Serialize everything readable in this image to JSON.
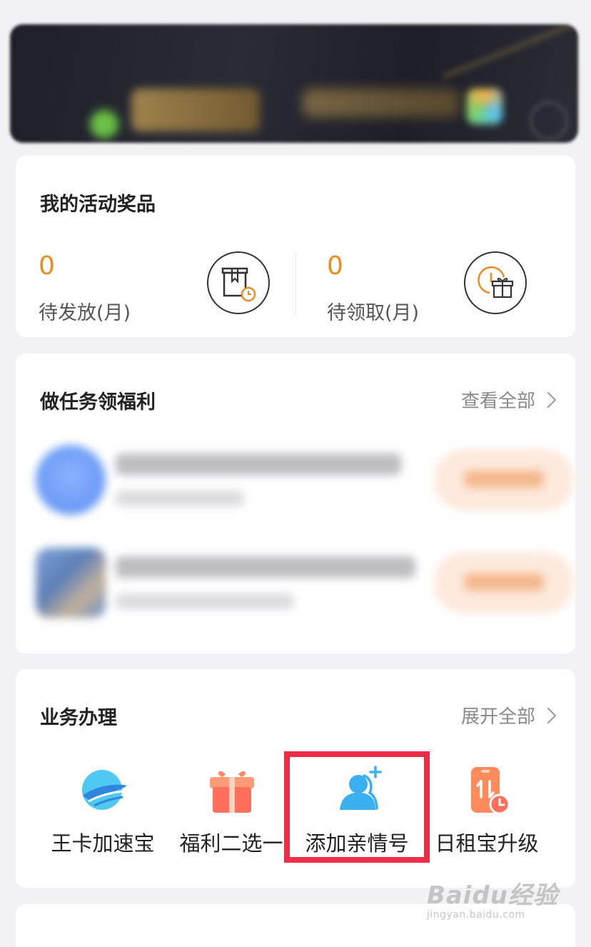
{
  "prizes": {
    "title": "我的活动奖品",
    "pending_release": {
      "value": "0",
      "label": "待发放(月)"
    },
    "pending_claim": {
      "value": "0",
      "label": "待领取(月)"
    }
  },
  "tasks": {
    "title": "做任务领福利",
    "view_all": "查看全部"
  },
  "business": {
    "title": "业务办理",
    "expand_all": "展开全部",
    "items": [
      {
        "label": "王卡加速宝"
      },
      {
        "label": "福利二选一"
      },
      {
        "label": "添加亲情号"
      },
      {
        "label": "日租宝升级"
      }
    ]
  },
  "watermark": {
    "main": "Baidu经验",
    "sub": "jingyan.baidu.com"
  },
  "colors": {
    "accent_orange": "#f08a1f",
    "highlight_red": "#ee2c45",
    "icon_blue": "#3ab0f0"
  }
}
